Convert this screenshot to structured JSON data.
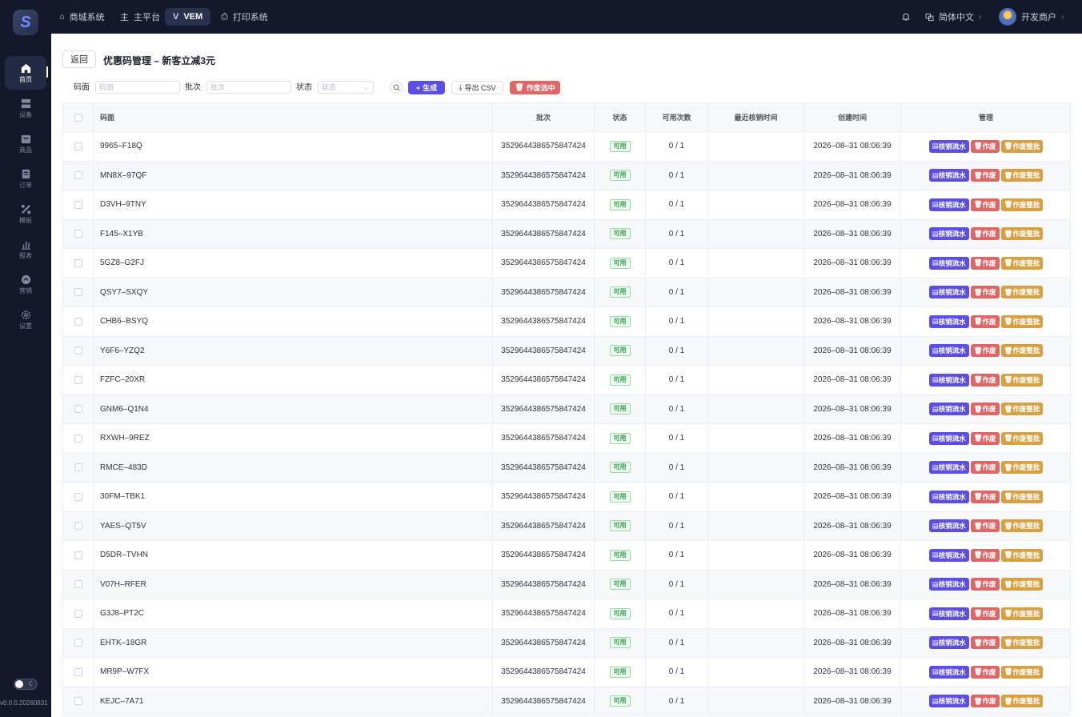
{
  "topbar": {
    "tabs": [
      {
        "icon": "⌂",
        "label": "商城系统",
        "active": false
      },
      {
        "icon": "主",
        "label": "主平台",
        "active": false
      },
      {
        "icon": "V",
        "label": "VEM",
        "active": true
      },
      {
        "icon": "⎙",
        "label": "打印系统",
        "active": false
      }
    ],
    "language": "简体中文",
    "user": "开发商户"
  },
  "sidebar": {
    "logo": "S",
    "items": [
      {
        "label": "首页",
        "icon": "home-icon",
        "active": true
      },
      {
        "label": "设备",
        "icon": "device-icon",
        "active": false
      },
      {
        "label": "商品",
        "icon": "bag-icon",
        "active": false
      },
      {
        "label": "订单",
        "icon": "order-icon",
        "active": false
      },
      {
        "label": "模板",
        "icon": "template-icon",
        "active": false
      },
      {
        "label": "报表",
        "icon": "chart-icon",
        "active": false
      },
      {
        "label": "营销",
        "icon": "marketing-icon",
        "active": false
      },
      {
        "label": "设置",
        "icon": "gear-icon",
        "active": false
      }
    ],
    "version": "v0.0.0.20260831"
  },
  "page": {
    "back_label": "返回",
    "title": "优惠码管理 – 新客立减3元"
  },
  "filters": {
    "code_label": "码面",
    "code_placeholder": "码面",
    "batch_label": "批次",
    "batch_placeholder": "批次",
    "status_label": "状态",
    "status_placeholder": "状态",
    "generate_label": "生成",
    "export_label": "导出 CSV",
    "void_selected_label": "作废选中"
  },
  "table": {
    "headers": {
      "code": "码面",
      "batch": "批次",
      "status": "状态",
      "uses": "可用次数",
      "last_used": "最近核销时间",
      "created": "创建时间",
      "manage": "管理"
    },
    "action_labels": {
      "flow": "核销流水",
      "void": "作废",
      "void_batch": "作废整批"
    },
    "rows": [
      {
        "code": "9965–F18Q",
        "batch": "3529644386575847424",
        "status": "可用",
        "uses": "0 / 1",
        "last_used": "",
        "created": "2026–08–31 08:06:39"
      },
      {
        "code": "MN8X–97QF",
        "batch": "3529644386575847424",
        "status": "可用",
        "uses": "0 / 1",
        "last_used": "",
        "created": "2026–08–31 08:06:39"
      },
      {
        "code": "D3VH–9TNY",
        "batch": "3529644386575847424",
        "status": "可用",
        "uses": "0 / 1",
        "last_used": "",
        "created": "2026–08–31 08:06:39"
      },
      {
        "code": "F145–X1YB",
        "batch": "3529644386575847424",
        "status": "可用",
        "uses": "0 / 1",
        "last_used": "",
        "created": "2026–08–31 08:06:39"
      },
      {
        "code": "5GZ8–G2FJ",
        "batch": "3529644386575847424",
        "status": "可用",
        "uses": "0 / 1",
        "last_used": "",
        "created": "2026–08–31 08:06:39"
      },
      {
        "code": "QSY7–SXQY",
        "batch": "3529644386575847424",
        "status": "可用",
        "uses": "0 / 1",
        "last_used": "",
        "created": "2026–08–31 08:06:39"
      },
      {
        "code": "CHB6–BSYQ",
        "batch": "3529644386575847424",
        "status": "可用",
        "uses": "0 / 1",
        "last_used": "",
        "created": "2026–08–31 08:06:39"
      },
      {
        "code": "Y6F6–YZQ2",
        "batch": "3529644386575847424",
        "status": "可用",
        "uses": "0 / 1",
        "last_used": "",
        "created": "2026–08–31 08:06:39"
      },
      {
        "code": "FZFC–20XR",
        "batch": "3529644386575847424",
        "status": "可用",
        "uses": "0 / 1",
        "last_used": "",
        "created": "2026–08–31 08:06:39"
      },
      {
        "code": "GNM6–Q1N4",
        "batch": "3529644386575847424",
        "status": "可用",
        "uses": "0 / 1",
        "last_used": "",
        "created": "2026–08–31 08:06:39"
      },
      {
        "code": "RXWH–9REZ",
        "batch": "3529644386575847424",
        "status": "可用",
        "uses": "0 / 1",
        "last_used": "",
        "created": "2026–08–31 08:06:39"
      },
      {
        "code": "RMCE–483D",
        "batch": "3529644386575847424",
        "status": "可用",
        "uses": "0 / 1",
        "last_used": "",
        "created": "2026–08–31 08:06:39"
      },
      {
        "code": "30FM–TBK1",
        "batch": "3529644386575847424",
        "status": "可用",
        "uses": "0 / 1",
        "last_used": "",
        "created": "2026–08–31 08:06:39"
      },
      {
        "code": "YAES–QT5V",
        "batch": "3529644386575847424",
        "status": "可用",
        "uses": "0 / 1",
        "last_used": "",
        "created": "2026–08–31 08:06:39"
      },
      {
        "code": "D5DR–TVHN",
        "batch": "3529644386575847424",
        "status": "可用",
        "uses": "0 / 1",
        "last_used": "",
        "created": "2026–08–31 08:06:39"
      },
      {
        "code": "V07H–RFER",
        "batch": "3529644386575847424",
        "status": "可用",
        "uses": "0 / 1",
        "last_used": "",
        "created": "2026–08–31 08:06:39"
      },
      {
        "code": "G3J8–PT2C",
        "batch": "3529644386575847424",
        "status": "可用",
        "uses": "0 / 1",
        "last_used": "",
        "created": "2026–08–31 08:06:39"
      },
      {
        "code": "EHTK–18GR",
        "batch": "3529644386575847424",
        "status": "可用",
        "uses": "0 / 1",
        "last_used": "",
        "created": "2026–08–31 08:06:39"
      },
      {
        "code": "MR9P–W7FX",
        "batch": "3529644386575847424",
        "status": "可用",
        "uses": "0 / 1",
        "last_used": "",
        "created": "2026–08–31 08:06:39"
      },
      {
        "code": "KEJC–7A71",
        "batch": "3529644386575847424",
        "status": "可用",
        "uses": "0 / 1",
        "last_used": "",
        "created": "2026–08–31 08:06:39"
      }
    ]
  },
  "colors": {
    "primary": "#5d4ee3",
    "danger": "#e06666",
    "warning": "#d9a042",
    "success": "#2f9e4a",
    "sidebar_bg": "#13182b"
  }
}
